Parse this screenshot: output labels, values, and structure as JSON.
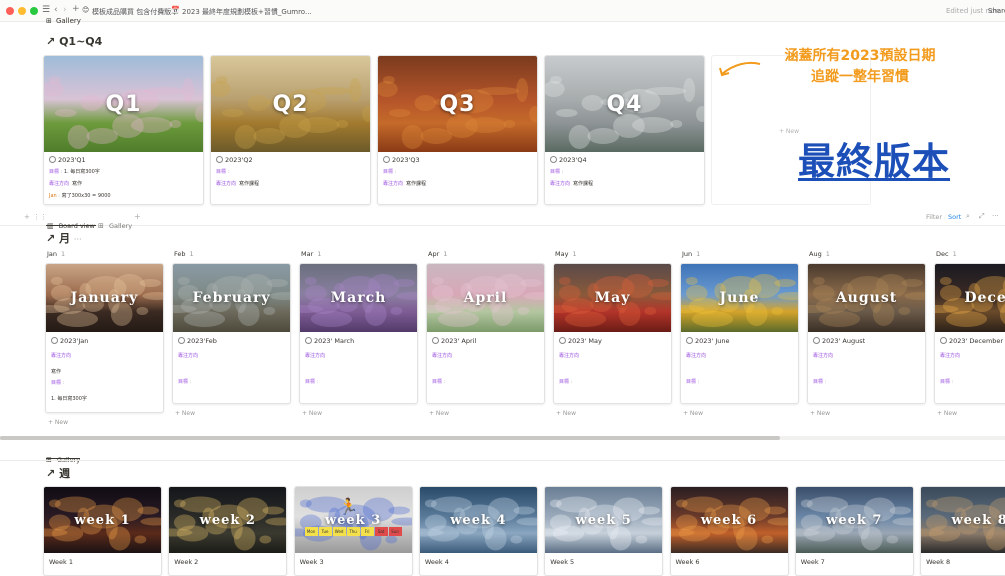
{
  "topbar": {
    "breadcrumb_1": "模板成品購買 包含付費版本",
    "breadcrumb_2": "2023 最終年度規劃模板+習慣_Gumro...",
    "edited": "Edited just now",
    "share": "Share"
  },
  "gallery_tab_top": "Gallery",
  "quarter_section": {
    "title": "Q1~Q4",
    "cards": [
      {
        "image_text": "Q1",
        "title": "2023'Q1",
        "prop_goal_label": "目標",
        "prop_goal_value": "1. 每日寫300字",
        "prop_dir_label": "專注方向",
        "prop_dir_value": "寫作",
        "prop_jan_label": "Jan",
        "prop_jan_value": "寫了300x30 = 9000"
      },
      {
        "image_text": "Q2",
        "title": "2023'Q2",
        "prop_goal_label": "目標",
        "prop_dir_label": "專注方向",
        "prop_dir_value": "寫作課程"
      },
      {
        "image_text": "Q3",
        "title": "2023'Q3",
        "prop_goal_label": "目標",
        "prop_dir_label": "專注方向",
        "prop_dir_value": "寫作課程"
      },
      {
        "image_text": "Q4",
        "title": "2023'Q4",
        "prop_goal_label": "目標",
        "prop_dir_label": "專注方向",
        "prop_dir_value": "寫作課程"
      }
    ],
    "new_label": "+ New"
  },
  "annotation": {
    "line1": "涵蓋所有2023預設日期",
    "line2": "追蹤一整年習慣",
    "headline": "最終版本"
  },
  "board_toolbar": {
    "board_view": "Board view",
    "gallery": "Gallery",
    "filter": "Filter",
    "sort": "Sort"
  },
  "month_section": {
    "title": "月",
    "more": "···",
    "columns": [
      {
        "name": "Jan",
        "count": "1",
        "image_text": "January",
        "title": "2023'Jan",
        "dir": "專注方向",
        "goal": "目標",
        "extra1": "寫作",
        "extra2": "1. 每日寫300字"
      },
      {
        "name": "Feb",
        "count": "1",
        "image_text": "February",
        "title": "2023'Feb",
        "dir": "專注方向",
        "goal": "目標"
      },
      {
        "name": "Mar",
        "count": "1",
        "image_text": "March",
        "title": "2023' March",
        "dir": "專注方向",
        "goal": "目標"
      },
      {
        "name": "Apr",
        "count": "1",
        "image_text": "April",
        "title": "2023' April",
        "dir": "專注方向",
        "goal": "目標"
      },
      {
        "name": "May",
        "count": "1",
        "image_text": "May",
        "title": "2023' May",
        "dir": "專注方向",
        "goal": "目標"
      },
      {
        "name": "Jun",
        "count": "1",
        "image_text": "June",
        "title": "2023' June",
        "dir": "專注方向",
        "goal": "目標"
      },
      {
        "name": "Aug",
        "count": "1",
        "image_text": "August",
        "title": "2023' August",
        "dir": "專注方向",
        "goal": "目標"
      },
      {
        "name": "Dec",
        "count": "1",
        "image_text": "Decem",
        "title": "2023' December",
        "dir": "專注方向",
        "goal": "目標"
      }
    ],
    "new_label": "+ New"
  },
  "week_section": {
    "gallery_tab": "Gallery",
    "title": "週",
    "cards": [
      {
        "image_text": "week 1",
        "title": "Week 1"
      },
      {
        "image_text": "week 2",
        "title": "Week 2"
      },
      {
        "image_text": "week 3",
        "title": "Week 3"
      },
      {
        "image_text": "week 4",
        "title": "Week 4"
      },
      {
        "image_text": "week 5",
        "title": "Week 5"
      },
      {
        "image_text": "week 6",
        "title": "Week 6"
      },
      {
        "image_text": "week 7",
        "title": "Week 7"
      },
      {
        "image_text": "week 8",
        "title": "Week 8"
      }
    ],
    "calendar_days": [
      "Mon",
      "Tue",
      "Wed",
      "Thu",
      "Fri",
      "Sat",
      "Sun"
    ]
  },
  "colors": {
    "accent_orange": "#f29b1d",
    "headline_blue": "#1c4fb8",
    "prop_purple": "#9b51e0",
    "link_blue": "#2383e2"
  }
}
